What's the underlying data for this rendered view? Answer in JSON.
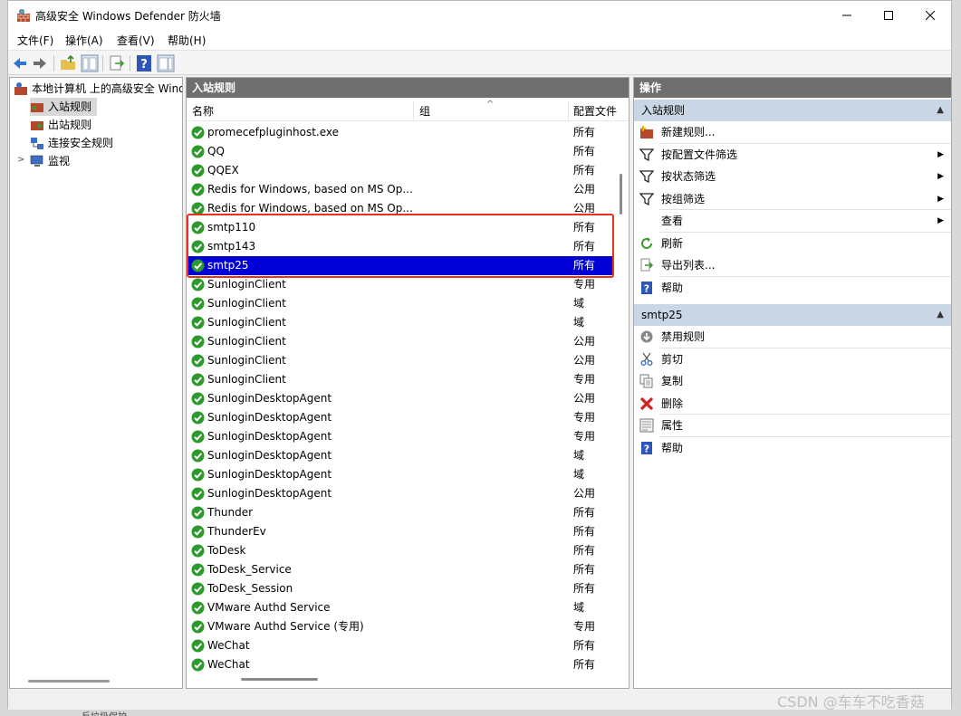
{
  "window": {
    "title": "高级安全 Windows Defender 防火墙"
  },
  "menu": [
    "文件(F)",
    "操作(A)",
    "查看(V)",
    "帮助(H)"
  ],
  "tree": {
    "root": "本地计算机 上的高级安全 Windows",
    "items": [
      "入站规则",
      "出站规则",
      "连接安全规则",
      "监视"
    ]
  },
  "center": {
    "header": "入站规则",
    "columns": {
      "name": "名称",
      "group": "组",
      "profile": "配置文件"
    },
    "rows": [
      {
        "name": "promecefpluginhost.exe",
        "profile": "所有"
      },
      {
        "name": "QQ",
        "profile": "所有"
      },
      {
        "name": "QQEX",
        "profile": "所有"
      },
      {
        "name": "Redis for Windows, based on MS Op...",
        "profile": "公用"
      },
      {
        "name": "Redis for Windows, based on MS Op...",
        "profile": "公用"
      },
      {
        "name": "smtp110",
        "profile": "所有"
      },
      {
        "name": "smtp143",
        "profile": "所有"
      },
      {
        "name": "smtp25",
        "profile": "所有"
      },
      {
        "name": "SunloginClient",
        "profile": "专用"
      },
      {
        "name": "SunloginClient",
        "profile": "域"
      },
      {
        "name": "SunloginClient",
        "profile": "域"
      },
      {
        "name": "SunloginClient",
        "profile": "公用"
      },
      {
        "name": "SunloginClient",
        "profile": "公用"
      },
      {
        "name": "SunloginClient",
        "profile": "专用"
      },
      {
        "name": "SunloginDesktopAgent",
        "profile": "公用"
      },
      {
        "name": "SunloginDesktopAgent",
        "profile": "专用"
      },
      {
        "name": "SunloginDesktopAgent",
        "profile": "专用"
      },
      {
        "name": "SunloginDesktopAgent",
        "profile": "域"
      },
      {
        "name": "SunloginDesktopAgent",
        "profile": "域"
      },
      {
        "name": "SunloginDesktopAgent",
        "profile": "公用"
      },
      {
        "name": "Thunder",
        "profile": "所有"
      },
      {
        "name": "ThunderEv",
        "profile": "所有"
      },
      {
        "name": "ToDesk",
        "profile": "所有"
      },
      {
        "name": "ToDesk_Service",
        "profile": "所有"
      },
      {
        "name": "ToDesk_Session",
        "profile": "所有"
      },
      {
        "name": "VMware Authd Service",
        "profile": "域"
      },
      {
        "name": "VMware Authd Service (专用)",
        "profile": "专用"
      },
      {
        "name": "WeChat",
        "profile": "所有"
      },
      {
        "name": "WeChat",
        "profile": "所有"
      }
    ],
    "selected_index": 7
  },
  "actions": {
    "header": "操作",
    "section1": {
      "title": "入站规则",
      "items": [
        "新建规则...",
        "按配置文件筛选",
        "按状态筛选",
        "按组筛选",
        "查看",
        "刷新",
        "导出列表...",
        "帮助"
      ]
    },
    "section2": {
      "title": "smtp25",
      "items": [
        "禁用规则",
        "剪切",
        "复制",
        "删除",
        "属性",
        "帮助"
      ]
    }
  },
  "colors": {
    "selection": "#0000d7",
    "section_bg": "#c9d6e5",
    "pane_header": "#6f6f6f",
    "highlight_box": "#e8321e",
    "check_green": "#2e9a2e"
  },
  "watermark": "CSDN @车车不吃香菇",
  "background_text": "反垃圾保护"
}
